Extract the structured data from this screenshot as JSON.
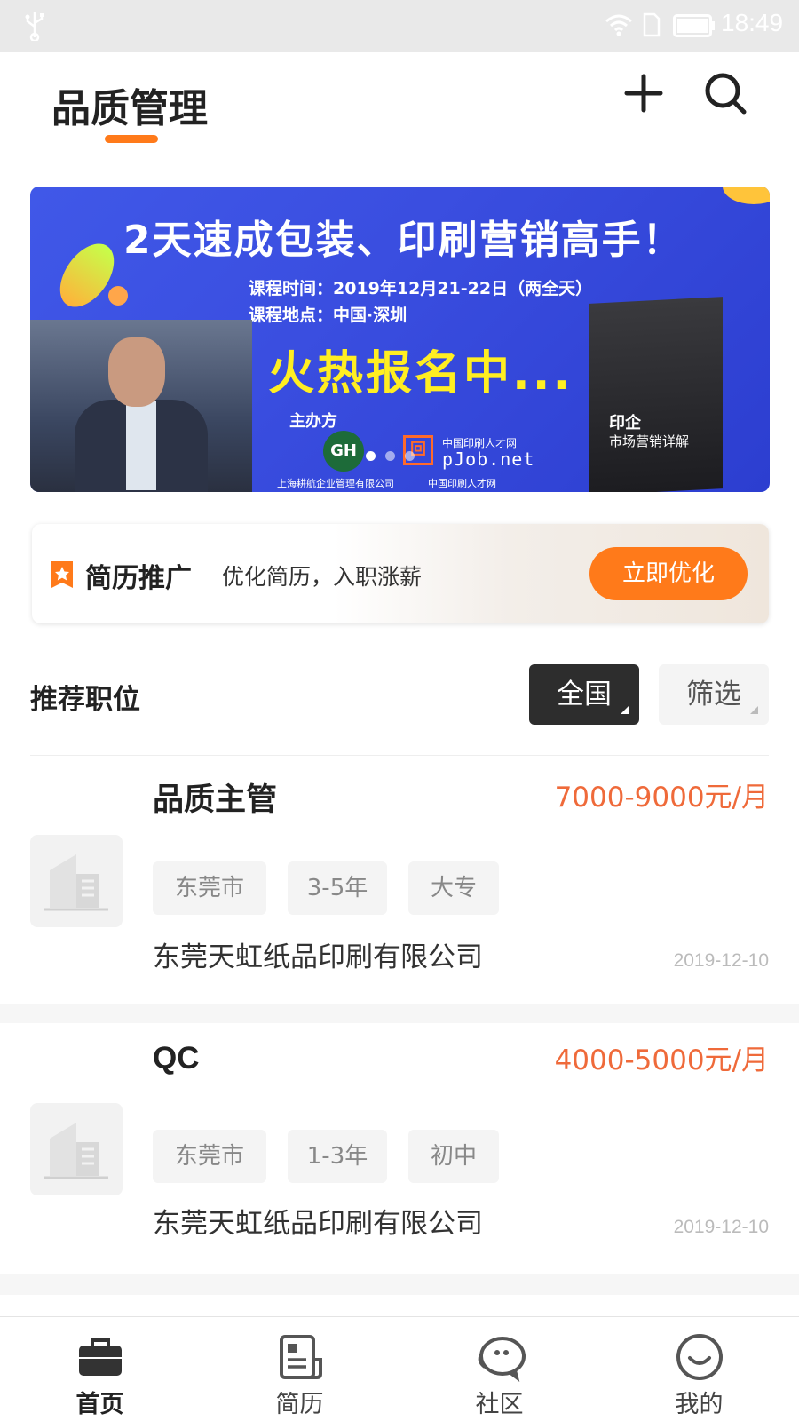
{
  "status_bar": {
    "time": "18:49"
  },
  "header": {
    "title": "品质管理"
  },
  "banner": {
    "headline": "2天速成包装、印刷营销高手！",
    "course_time": "课程时间：2019年12月21-22日（两全天）",
    "course_location": "课程地点：中国·深圳",
    "cta": "火热报名中...",
    "organizer_label": "主办方",
    "gh_logo": "GH",
    "site_cn": "中国印刷人才网",
    "site": "pJob.net",
    "org_name_1": "上海耕航企业管理有限公司",
    "org_name_2": "中国印刷人才网",
    "book_title": "印企",
    "book_subtitle": "市场营销详解",
    "slide_count": 3,
    "active_slide": 1
  },
  "promo": {
    "title": "简历推广",
    "description": "优化简历，入职涨薪",
    "button_label": "立即优化"
  },
  "recommended": {
    "title": "推荐职位",
    "region_filter": "全国",
    "more_filter": "筛选"
  },
  "jobs": [
    {
      "title": "品质主管",
      "salary": "7000-9000元/月",
      "tags": [
        "东莞市",
        "3-5年",
        "大专"
      ],
      "company": "东莞天虹纸品印刷有限公司",
      "date": "2019-12-10"
    },
    {
      "title": "QC",
      "salary": "4000-5000元/月",
      "tags": [
        "东莞市",
        "1-3年",
        "初中"
      ],
      "company": "东莞天虹纸品印刷有限公司",
      "date": "2019-12-10"
    }
  ],
  "bottom_nav": {
    "items": [
      {
        "label": "首页",
        "icon": "briefcase-icon",
        "active": true
      },
      {
        "label": "简历",
        "icon": "resume-icon",
        "active": false
      },
      {
        "label": "社区",
        "icon": "chat-bubble-icon",
        "active": false
      },
      {
        "label": "我的",
        "icon": "smile-icon",
        "active": false
      }
    ]
  },
  "colors": {
    "accent": "#ff7a1a",
    "salary": "#ef6a3a",
    "banner_blue": "#3a4ee0"
  }
}
